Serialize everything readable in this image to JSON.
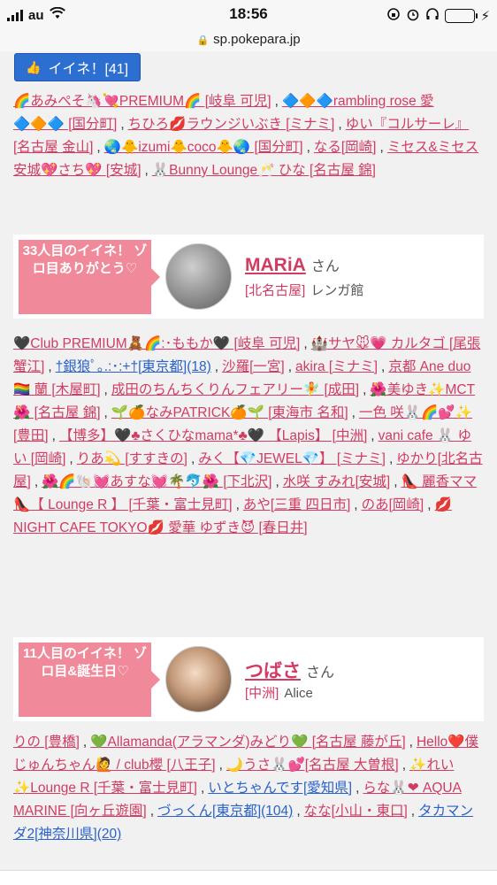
{
  "status_bar": {
    "carrier": "au",
    "time": "18:56",
    "battery_percent": 0.72,
    "battery_color": "#2ecc40"
  },
  "browser": {
    "url": "sp.pokepara.jp"
  },
  "like_button": {
    "label": "イイネ！[41]",
    "icon": "thumbs-up-icon"
  },
  "likers_top": [
    {
      "text": "🌈あみぺそ🦄💘PREMIUM🌈 [岐阜 可児]",
      "color": "pink"
    },
    {
      "text": "🔷🔶🔷rambling rose 愛🔷🔶🔷 [国分町]",
      "color": "pink"
    },
    {
      "text": "ちひろ💋ラウンジいぶき [ミナミ]",
      "color": "pink"
    },
    {
      "text": "ゆい『コルサーレ』 [名古屋 金山]",
      "color": "pink"
    },
    {
      "text": "🌏🐥izumi🐥coco🐥🌏 [国分町]",
      "color": "pink"
    },
    {
      "text": "なる[岡崎]",
      "color": "pink"
    },
    {
      "text": "ミセス&ミセス安城💖さち💖 [安城]",
      "color": "pink"
    },
    {
      "text": "🐰Bunny Lounge🥂 ひな [名古屋 錦]",
      "color": "pink"
    }
  ],
  "card1": {
    "label": "33人目のイイネ！ ゾロ目ありがとう♡",
    "cast_name": "MARiA",
    "san": "さん",
    "area": "[北名古屋]",
    "shop": "レンガ館"
  },
  "likers_mid": [
    {
      "text": "🖤Club PREMIUM🧸🌈:･ももか🖤 [岐阜 可児]",
      "color": "pink"
    },
    {
      "text": "🏰サヤ🐭💗 カルタゴ [尾張 蟹江]",
      "color": "pink"
    },
    {
      "text": "†銀狼ﾟ｡.:･:+†[東京都](18)",
      "color": "blue"
    },
    {
      "text": "沙羅[一宮]",
      "color": "pink"
    },
    {
      "text": "akira [ミナミ]",
      "color": "pink"
    },
    {
      "text": "京都 Ane duo 🏳️‍🌈 蘭 [木屋町]",
      "color": "pink"
    },
    {
      "text": "成田のちんちくりんフェアリー🧚 [成田]",
      "color": "pink"
    },
    {
      "text": "🌺美ゆき✨MCT🌺 [名古屋 錦]",
      "color": "pink"
    },
    {
      "text": "🌱🍊なみPATRICK🍊🌱 [東海市 名和]",
      "color": "pink"
    },
    {
      "text": "一色 咲🐰🌈💕✨ [豊田]",
      "color": "pink"
    },
    {
      "text": "【博多】🖤♣さくひなmama*♣🖤 【Lapis】 [中洲]",
      "color": "pink"
    },
    {
      "text": "vani cafe 🐰 ゆい [岡崎]",
      "color": "pink"
    },
    {
      "text": "りあ💫 [すすきの]",
      "color": "pink"
    },
    {
      "text": "みく【💎JEWEL💎】 [ミナミ]",
      "color": "pink"
    },
    {
      "text": "ゆかり[北名古屋]",
      "color": "pink"
    },
    {
      "text": "🌺🌈🐚💓あすな💓🌴🐬🌺 [下北沢]",
      "color": "pink"
    },
    {
      "text": "水咲 すみれ[安城]",
      "color": "pink"
    },
    {
      "text": "👠 麗香ママ 👠【 Lounge R 】 [千葉・富士見町]",
      "color": "pink"
    },
    {
      "text": "あや[三重 四日市]",
      "color": "pink"
    },
    {
      "text": "のあ[岡崎]",
      "color": "pink"
    },
    {
      "text": "💋NIGHT CAFE TOKYO💋 愛華 ゆずき😈 [春日井]",
      "color": "pink"
    }
  ],
  "card2": {
    "label": "11人目のイイネ！ ゾロ目&誕生日♡",
    "cast_name": "つばさ",
    "san": "さん",
    "area": "[中洲]",
    "shop": "Alice"
  },
  "likers_bottom": [
    {
      "text": "りの [豊橋]",
      "color": "pink"
    },
    {
      "text": "💚Allamanda(アラマンダ)みどり💚 [名古屋 藤が丘]",
      "color": "pink"
    },
    {
      "text": "Hello❤️僕じゅんちゃん🙋 / club櫻 [八王子]",
      "color": "pink"
    },
    {
      "text": "🌙うさ🐰💕[名古屋 大曽根]",
      "color": "pink"
    },
    {
      "text": "✨れい✨Lounge R [千葉・富士見町]",
      "color": "pink"
    },
    {
      "text": "いとちゃんです[愛知県]",
      "color": "blue"
    },
    {
      "text": "らな🐰❤ AQUA MARINE [向ヶ丘遊園]",
      "color": "pink"
    },
    {
      "text": "づっくん[東京都](104)",
      "color": "blue"
    },
    {
      "text": "なな[小山・東口]",
      "color": "pink"
    },
    {
      "text": "タカマンダ2[神奈川県](20)",
      "color": "blue"
    }
  ]
}
